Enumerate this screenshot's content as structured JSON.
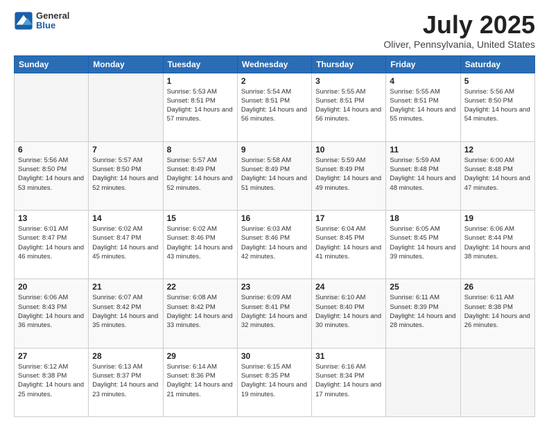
{
  "header": {
    "logo_general": "General",
    "logo_blue": "Blue",
    "month_title": "July 2025",
    "location": "Oliver, Pennsylvania, United States"
  },
  "weekdays": [
    "Sunday",
    "Monday",
    "Tuesday",
    "Wednesday",
    "Thursday",
    "Friday",
    "Saturday"
  ],
  "weeks": [
    [
      {
        "day": "",
        "info": ""
      },
      {
        "day": "",
        "info": ""
      },
      {
        "day": "1",
        "info": "Sunrise: 5:53 AM\nSunset: 8:51 PM\nDaylight: 14 hours and 57 minutes."
      },
      {
        "day": "2",
        "info": "Sunrise: 5:54 AM\nSunset: 8:51 PM\nDaylight: 14 hours and 56 minutes."
      },
      {
        "day": "3",
        "info": "Sunrise: 5:55 AM\nSunset: 8:51 PM\nDaylight: 14 hours and 56 minutes."
      },
      {
        "day": "4",
        "info": "Sunrise: 5:55 AM\nSunset: 8:51 PM\nDaylight: 14 hours and 55 minutes."
      },
      {
        "day": "5",
        "info": "Sunrise: 5:56 AM\nSunset: 8:50 PM\nDaylight: 14 hours and 54 minutes."
      }
    ],
    [
      {
        "day": "6",
        "info": "Sunrise: 5:56 AM\nSunset: 8:50 PM\nDaylight: 14 hours and 53 minutes."
      },
      {
        "day": "7",
        "info": "Sunrise: 5:57 AM\nSunset: 8:50 PM\nDaylight: 14 hours and 52 minutes."
      },
      {
        "day": "8",
        "info": "Sunrise: 5:57 AM\nSunset: 8:49 PM\nDaylight: 14 hours and 52 minutes."
      },
      {
        "day": "9",
        "info": "Sunrise: 5:58 AM\nSunset: 8:49 PM\nDaylight: 14 hours and 51 minutes."
      },
      {
        "day": "10",
        "info": "Sunrise: 5:59 AM\nSunset: 8:49 PM\nDaylight: 14 hours and 49 minutes."
      },
      {
        "day": "11",
        "info": "Sunrise: 5:59 AM\nSunset: 8:48 PM\nDaylight: 14 hours and 48 minutes."
      },
      {
        "day": "12",
        "info": "Sunrise: 6:00 AM\nSunset: 8:48 PM\nDaylight: 14 hours and 47 minutes."
      }
    ],
    [
      {
        "day": "13",
        "info": "Sunrise: 6:01 AM\nSunset: 8:47 PM\nDaylight: 14 hours and 46 minutes."
      },
      {
        "day": "14",
        "info": "Sunrise: 6:02 AM\nSunset: 8:47 PM\nDaylight: 14 hours and 45 minutes."
      },
      {
        "day": "15",
        "info": "Sunrise: 6:02 AM\nSunset: 8:46 PM\nDaylight: 14 hours and 43 minutes."
      },
      {
        "day": "16",
        "info": "Sunrise: 6:03 AM\nSunset: 8:46 PM\nDaylight: 14 hours and 42 minutes."
      },
      {
        "day": "17",
        "info": "Sunrise: 6:04 AM\nSunset: 8:45 PM\nDaylight: 14 hours and 41 minutes."
      },
      {
        "day": "18",
        "info": "Sunrise: 6:05 AM\nSunset: 8:45 PM\nDaylight: 14 hours and 39 minutes."
      },
      {
        "day": "19",
        "info": "Sunrise: 6:06 AM\nSunset: 8:44 PM\nDaylight: 14 hours and 38 minutes."
      }
    ],
    [
      {
        "day": "20",
        "info": "Sunrise: 6:06 AM\nSunset: 8:43 PM\nDaylight: 14 hours and 36 minutes."
      },
      {
        "day": "21",
        "info": "Sunrise: 6:07 AM\nSunset: 8:42 PM\nDaylight: 14 hours and 35 minutes."
      },
      {
        "day": "22",
        "info": "Sunrise: 6:08 AM\nSunset: 8:42 PM\nDaylight: 14 hours and 33 minutes."
      },
      {
        "day": "23",
        "info": "Sunrise: 6:09 AM\nSunset: 8:41 PM\nDaylight: 14 hours and 32 minutes."
      },
      {
        "day": "24",
        "info": "Sunrise: 6:10 AM\nSunset: 8:40 PM\nDaylight: 14 hours and 30 minutes."
      },
      {
        "day": "25",
        "info": "Sunrise: 6:11 AM\nSunset: 8:39 PM\nDaylight: 14 hours and 28 minutes."
      },
      {
        "day": "26",
        "info": "Sunrise: 6:11 AM\nSunset: 8:38 PM\nDaylight: 14 hours and 26 minutes."
      }
    ],
    [
      {
        "day": "27",
        "info": "Sunrise: 6:12 AM\nSunset: 8:38 PM\nDaylight: 14 hours and 25 minutes."
      },
      {
        "day": "28",
        "info": "Sunrise: 6:13 AM\nSunset: 8:37 PM\nDaylight: 14 hours and 23 minutes."
      },
      {
        "day": "29",
        "info": "Sunrise: 6:14 AM\nSunset: 8:36 PM\nDaylight: 14 hours and 21 minutes."
      },
      {
        "day": "30",
        "info": "Sunrise: 6:15 AM\nSunset: 8:35 PM\nDaylight: 14 hours and 19 minutes."
      },
      {
        "day": "31",
        "info": "Sunrise: 6:16 AM\nSunset: 8:34 PM\nDaylight: 14 hours and 17 minutes."
      },
      {
        "day": "",
        "info": ""
      },
      {
        "day": "",
        "info": ""
      }
    ]
  ]
}
